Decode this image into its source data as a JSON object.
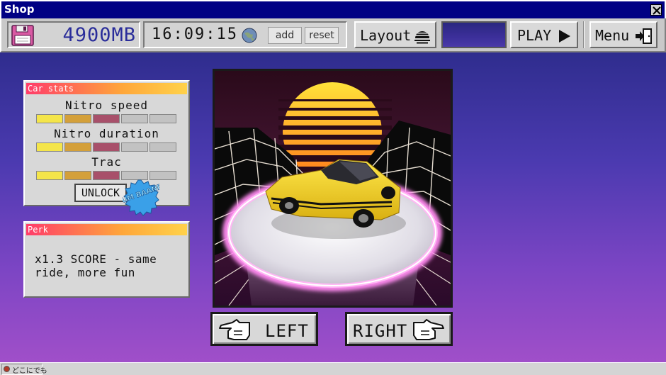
{
  "window": {
    "title": "Shop"
  },
  "toolbar": {
    "storage_value": "4900MB",
    "clock": "16:09:15",
    "add_label": "add",
    "reset_label": "reset",
    "layout_label": "Layout",
    "play_label": "PLAY",
    "menu_label": "Menu"
  },
  "car_stats": {
    "title": "Car stats",
    "stats": [
      {
        "label": "Nitro speed",
        "level": 3,
        "max": 5
      },
      {
        "label": "Nitro duration",
        "level": 3,
        "max": 5
      },
      {
        "label": "Trac",
        "level": 3,
        "max": 5
      }
    ],
    "unlock_label": "UNLOCK",
    "badge_text": "BUM BAAND"
  },
  "perk": {
    "title": "Perk",
    "description": "x1.3 SCORE - same ride, more fun"
  },
  "nav": {
    "left_label": "LEFT",
    "right_label": "RIGHT"
  },
  "status": {
    "text": "どこにでも"
  },
  "colors": {
    "titlebar": "#000084",
    "storage_text": "#2a2d9a",
    "car_body": "#f2d21a",
    "bar_fill": "#f4e54a"
  }
}
